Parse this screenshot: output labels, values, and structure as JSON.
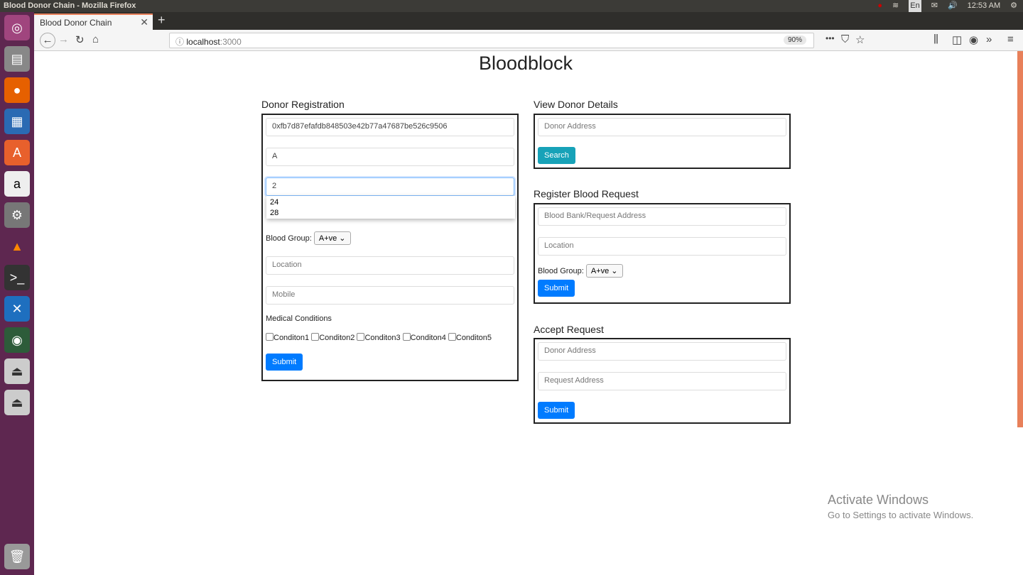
{
  "window_title": "Blood Donor Chain - Mozilla Firefox",
  "tray": {
    "lang": "En",
    "time": "12:53 AM"
  },
  "tab": {
    "title": "Blood Donor Chain"
  },
  "address": {
    "host": "localhost",
    "port": ":3000",
    "zoom": "90%"
  },
  "launcher": [
    "ubuntu-icon",
    "files-icon",
    "firefox-icon",
    "writer-icon",
    "software-icon",
    "amazon-icon",
    "settings-icon",
    "vlc-icon",
    "terminal-icon",
    "vscode-icon",
    "globe-icon",
    "usb-icon",
    "usb-icon",
    "trash-icon"
  ],
  "page": {
    "title": "Bloodblock",
    "donor_registration": {
      "heading": "Donor Registration",
      "address": "0xfb7d87efafdb848503e42b77a47687be526c9506",
      "name": "A",
      "age": "2",
      "age_suggestions": [
        "24",
        "28"
      ],
      "blood_group_label": "Blood Group:",
      "blood_group": "A+ve",
      "location_ph": "Location",
      "mobile_ph": "Mobile",
      "conditions_label": "Medical Conditions",
      "conditions": [
        "Conditon1",
        "Conditon2",
        "Conditon3",
        "Conditon4",
        "Conditon5"
      ],
      "submit": "Submit"
    },
    "view_donor": {
      "heading": "View Donor Details",
      "address_ph": "Donor Address",
      "search": "Search"
    },
    "register_request": {
      "heading": "Register Blood Request",
      "address_ph": "Blood Bank/Request Address",
      "location_ph": "Location",
      "blood_group_label": "Blood Group:",
      "blood_group": "A+ve",
      "submit": "Submit"
    },
    "accept_request": {
      "heading": "Accept Request",
      "donor_ph": "Donor Address",
      "request_ph": "Request Address",
      "submit": "Submit"
    }
  },
  "watermark": {
    "title": "Activate Windows",
    "subtitle": "Go to Settings to activate Windows."
  },
  "colors": {
    "primary": "#007bff",
    "info": "#17a2b8",
    "launcher": "#5e2750"
  }
}
